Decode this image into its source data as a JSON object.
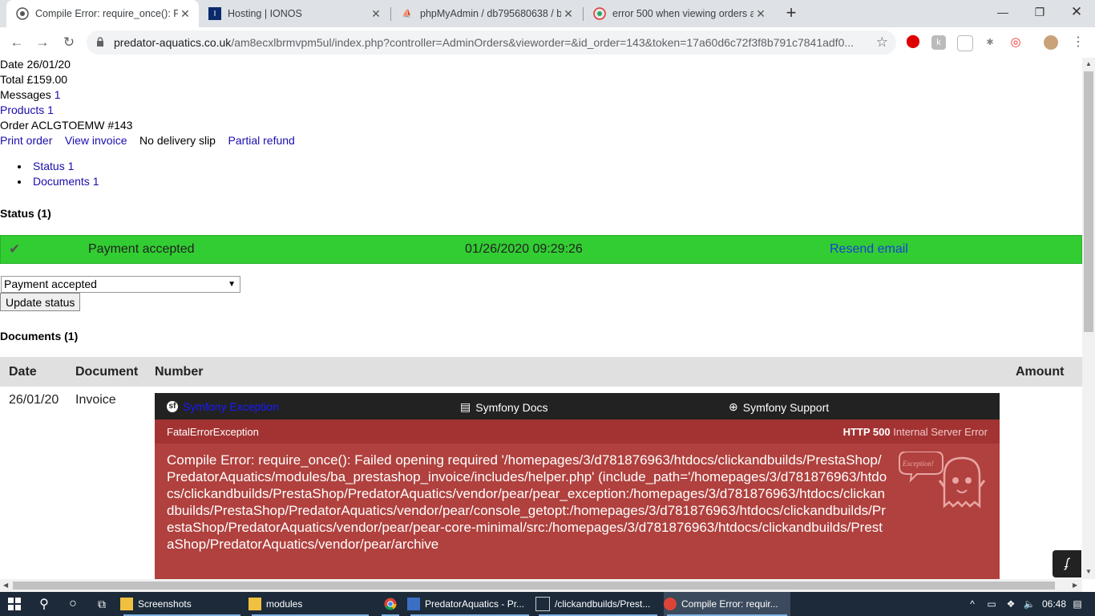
{
  "browser": {
    "tabs": [
      {
        "title": "Compile Error: require_once(): Fai",
        "active": true
      },
      {
        "title": "Hosting | IONOS",
        "active": false
      },
      {
        "title": "phpMyAdmin / db795680638 / b",
        "active": false
      },
      {
        "title": "error 500 when viewing orders ac",
        "active": false
      }
    ],
    "url_domain": "predator-aquatics.co.uk",
    "url_rest": "/am8ecxlbrmvpm5ul/index.php?controller=AdminOrders&vieworder=&id_order=143&token=17a60d6c72f3f8b791c7841adf0..."
  },
  "order": {
    "date_label": "Date 26/01/20",
    "total_label": "Total £159.00",
    "messages_label": "Messages",
    "messages_count": "1",
    "products_label": "Products 1",
    "order_label": "Order ACLGTOEMW #143",
    "links": {
      "print_order": "Print order",
      "view_invoice": "View invoice",
      "no_delivery_slip": "No delivery slip",
      "partial_refund": "Partial refund"
    },
    "subtabs": [
      "Status 1",
      "Documents 1"
    ]
  },
  "status_section": {
    "heading": "Status (1)",
    "row": {
      "status": "Payment accepted",
      "datetime": "01/26/2020 09:29:26",
      "action": "Resend email",
      "color": "#32cd32"
    },
    "select_value": "Payment accepted",
    "update_button": "Update status"
  },
  "documents_section": {
    "heading": "Documents (1)",
    "columns": [
      "Date",
      "Document",
      "Number",
      "Amount"
    ],
    "row": {
      "date": "26/01/20",
      "document": "Invoice"
    }
  },
  "symfony_error": {
    "nav": [
      "Symfony Exception",
      "Symfony Docs",
      "Symfony Support"
    ],
    "exception_class": "FatalErrorException",
    "http_code": "HTTP 500",
    "http_text": "Internal Server Error",
    "ghost_label": "Exception!",
    "message": "Compile Error: require_once(): Failed opening required '/homepages/3/d781876963/htdocs/clickandbuilds/PrestaShop/PredatorAquatics/modules/ba_prestashop_invoice/includes/helper.php' (include_path='/homepages/3/d781876963/htdocs/clickandbuilds/PrestaShop/PredatorAquatics/vendor/pear/pear_exception:/homepages/3/d781876963/htdocs/clickandbuilds/PrestaShop/PredatorAquatics/vendor/pear/console_getopt:/homepages/3/d781876963/htdocs/clickandbuilds/PrestaShop/PredatorAquatics/vendor/pear/pear-core-minimal/src:/homepages/3/d781876963/htdocs/clickandbuilds/PrestaShop/PredatorAquatics/vendor/pear/archive"
  },
  "taskbar": {
    "items": [
      "Screenshots",
      "modules",
      "PredatorAquatics - Pr...",
      "/clickandbuilds/Prest...",
      "Compile Error: requir..."
    ],
    "time": "06:48"
  }
}
